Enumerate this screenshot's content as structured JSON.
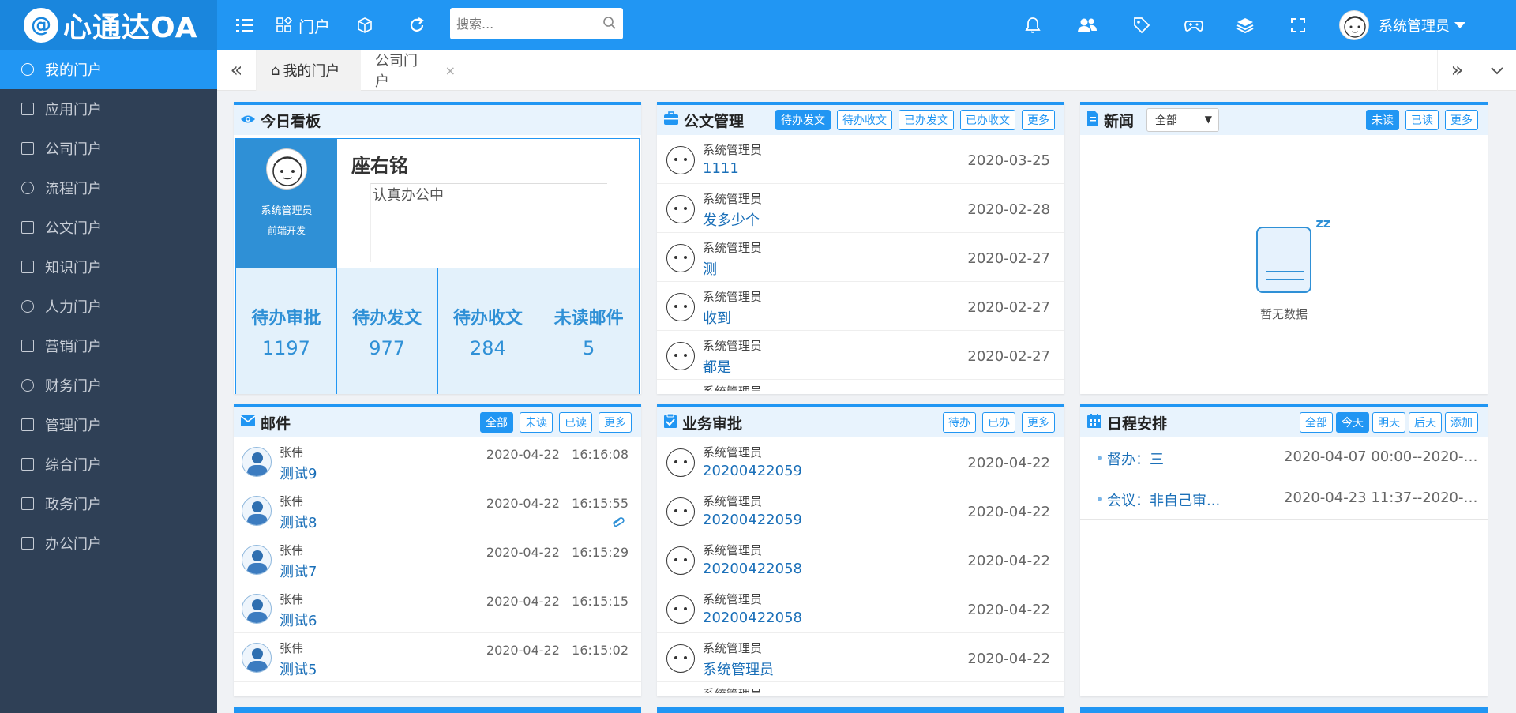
{
  "app": {
    "logo_mark": "@",
    "logo_text": "心通达OA"
  },
  "topbar": {
    "portal_label": "门户",
    "search_placeholder": "搜索...",
    "user_name": "系统管理员"
  },
  "sidebar": {
    "items": [
      {
        "label": "我的门户",
        "active": true
      },
      {
        "label": "应用门户"
      },
      {
        "label": "公司门户"
      },
      {
        "label": "流程门户"
      },
      {
        "label": "公文门户"
      },
      {
        "label": "知识门户"
      },
      {
        "label": "人力门户"
      },
      {
        "label": "营销门户"
      },
      {
        "label": "财务门户"
      },
      {
        "label": "管理门户"
      },
      {
        "label": "综合门户"
      },
      {
        "label": "政务门户"
      },
      {
        "label": "办公门户"
      }
    ]
  },
  "tabs": [
    {
      "label": "我的门户",
      "active": true
    },
    {
      "label": "公司门户",
      "close": "×"
    }
  ],
  "today": {
    "title": "今日看板",
    "user_name": "系统管理员",
    "user_dept": "前端开发",
    "signature_name": "座右铭",
    "motto": "认真办公中",
    "stats": [
      {
        "label": "待办审批",
        "value": "1197"
      },
      {
        "label": "待办发文",
        "value": "977"
      },
      {
        "label": "待办收文",
        "value": "284"
      },
      {
        "label": "未读邮件",
        "value": "5"
      }
    ]
  },
  "doc": {
    "title": "公文管理",
    "buttons": [
      "待办发文",
      "待办收文",
      "已办发文",
      "已办收文",
      "更多"
    ],
    "rows": [
      {
        "who": "系统管理员",
        "subject": "1111",
        "date": "2020-03-25"
      },
      {
        "who": "系统管理员",
        "subject": "发多少个",
        "date": "2020-02-28"
      },
      {
        "who": "系统管理员",
        "subject": "测",
        "date": "2020-02-27"
      },
      {
        "who": "系统管理员",
        "subject": "收到",
        "date": "2020-02-27"
      },
      {
        "who": "系统管理员",
        "subject": "都是",
        "date": "2020-02-27"
      }
    ],
    "partial_who": "系统管理员"
  },
  "news": {
    "title": "新闻",
    "select_value": "全部",
    "buttons": [
      "未读",
      "已读",
      "更多"
    ],
    "empty_text": "暂无数据"
  },
  "mail": {
    "title": "邮件",
    "buttons": [
      "全部",
      "未读",
      "已读",
      "更多"
    ],
    "rows": [
      {
        "who": "张伟",
        "subject": "测试9",
        "date": "2020-04-22",
        "time": "16:16:08"
      },
      {
        "who": "张伟",
        "subject": "测试8",
        "date": "2020-04-22",
        "time": "16:15:55"
      },
      {
        "who": "张伟",
        "subject": "测试7",
        "date": "2020-04-22",
        "time": "16:15:29"
      },
      {
        "who": "张伟",
        "subject": "测试6",
        "date": "2020-04-22",
        "time": "16:15:15"
      },
      {
        "who": "张伟",
        "subject": "测试5",
        "date": "2020-04-22",
        "time": "16:15:02"
      }
    ]
  },
  "biz": {
    "title": "业务审批",
    "buttons": [
      "待办",
      "已办",
      "更多"
    ],
    "rows": [
      {
        "who": "系统管理员",
        "subject": "20200422059",
        "date": "2020-04-22"
      },
      {
        "who": "系统管理员",
        "subject": "20200422059",
        "date": "2020-04-22"
      },
      {
        "who": "系统管理员",
        "subject": "20200422058",
        "date": "2020-04-22"
      },
      {
        "who": "系统管理员",
        "subject": "20200422058",
        "date": "2020-04-22"
      },
      {
        "who": "系统管理员",
        "subject": "系统管理员",
        "date": "2020-04-22"
      }
    ],
    "partial_who": "系统管理员"
  },
  "sched": {
    "title": "日程安排",
    "buttons": [
      "全部",
      "今天",
      "明天",
      "后天",
      "添加"
    ],
    "rows": [
      {
        "title": "督办：三",
        "time": "2020-04-07   00:00--2020-04..."
      },
      {
        "title": "会议：非自己审...",
        "time": "2020-04-23   11:37--2020-04..."
      }
    ]
  },
  "colors": {
    "primary": "#2196f3",
    "sidebar": "#2f4056",
    "panel_header": "#e8f3fd"
  }
}
